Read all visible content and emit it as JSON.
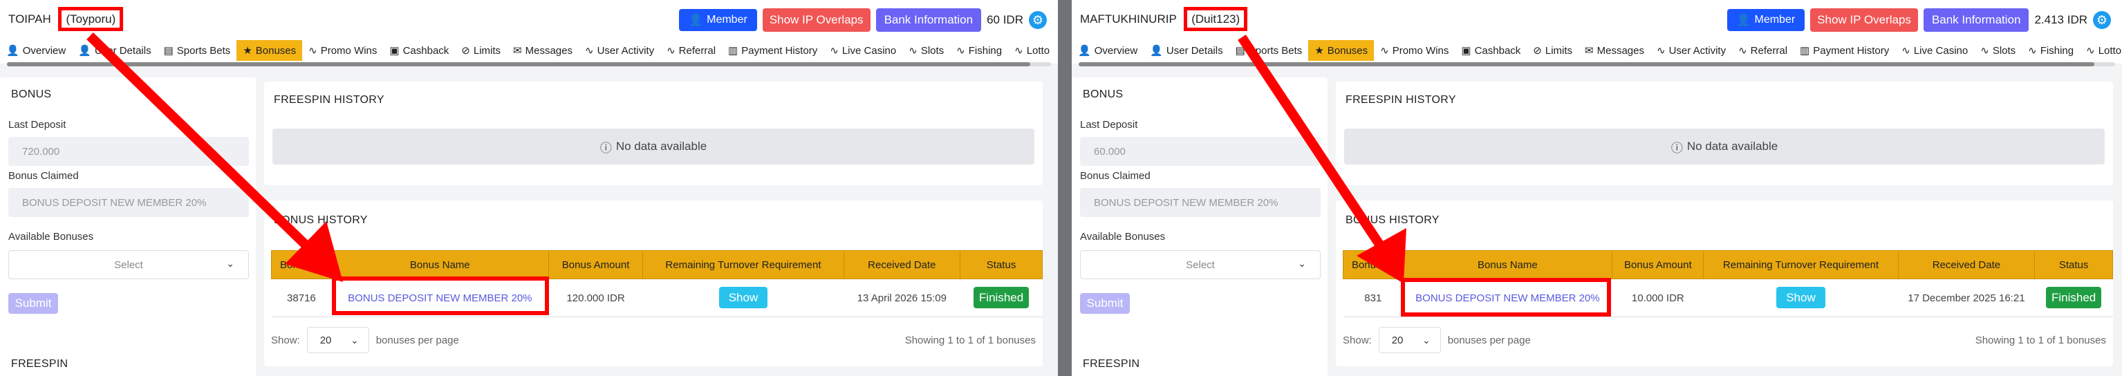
{
  "colors": {
    "highlight": "#ff0000",
    "accent": "#e9a80d",
    "member": "#1a56ff",
    "overlay": "#f05454",
    "bank": "#6b63f6",
    "finished": "#1f9d43",
    "show": "#28c3ed"
  },
  "tabs": [
    "Overview",
    "User Details",
    "Sports Bets",
    "Bonuses",
    "Promo Wins",
    "Cashback",
    "Limits",
    "Messages",
    "User Activity",
    "Referral",
    "Payment History",
    "Live Casino",
    "Slots",
    "Fishing",
    "Lotto"
  ],
  "labels": {
    "member": "Member",
    "show_ip": "Show IP Overlaps",
    "bank_info": "Bank Information",
    "bonus_title": "BONUS",
    "last_deposit": "Last Deposit",
    "bonus_claimed": "Bonus Claimed",
    "available_bonuses": "Available Bonuses",
    "select": "Select",
    "submit": "Submit",
    "freespin_history": "FREESPIN HISTORY",
    "no_data": "No data available",
    "bonus_history": "BONUS HISTORY",
    "freespin": "FREESPIN",
    "show": "Show:",
    "per_page": "bonuses per page",
    "page_size": "20",
    "show_btn": "Show",
    "cols": [
      "Bonus ID",
      "Bonus Name",
      "Bonus Amount",
      "Remaining Turnover Requirement",
      "Received Date",
      "Status"
    ]
  },
  "panels": [
    {
      "username": "TOIPAH",
      "nick": "(Toyporu)",
      "balance": "60 IDR",
      "last_deposit": "720.000",
      "bonus_claimed": "BONUS DEPOSIT NEW MEMBER 20%",
      "row": {
        "id": "38716",
        "name": "BONUS DEPOSIT NEW MEMBER 20%",
        "amount": "120.000 IDR",
        "date": "13 April 2026 15:09",
        "status": "Finished"
      },
      "showing": "Showing 1 to 1 of 1 bonuses"
    },
    {
      "username": "MAFTUKHINURIP",
      "nick": "(Duit123)",
      "balance": "2.413 IDR",
      "last_deposit": "60.000",
      "bonus_claimed": "BONUS DEPOSIT NEW MEMBER 20%",
      "row": {
        "id": "831",
        "name": "BONUS DEPOSIT NEW MEMBER 20%",
        "amount": "10.000 IDR",
        "date": "17 December 2025 16:21",
        "status": "Finished"
      },
      "showing": "Showing 1 to 1 of 1 bonuses"
    }
  ]
}
